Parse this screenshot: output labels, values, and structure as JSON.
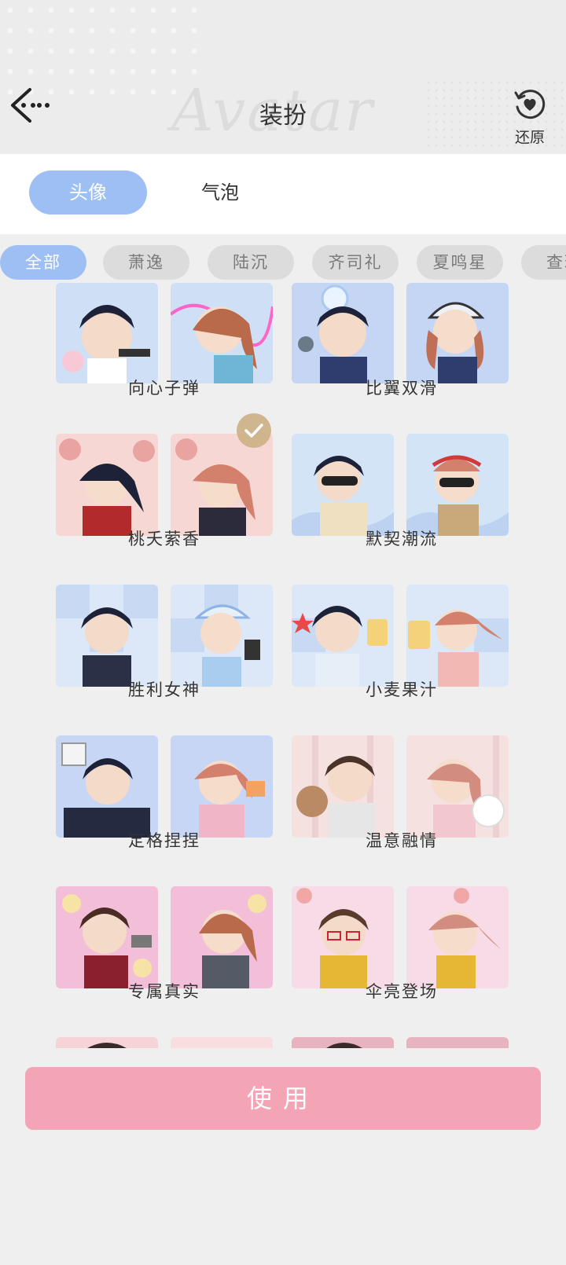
{
  "header": {
    "title": "装扮",
    "watermark": "Avatar",
    "restore_label": "还原",
    "icons": {
      "back": "back-arrow-icon",
      "restore": "heart-restore-icon"
    }
  },
  "tabs": [
    {
      "label": "头像",
      "active": true
    },
    {
      "label": "气泡",
      "active": false
    }
  ],
  "filters": [
    {
      "label": "全部",
      "active": true
    },
    {
      "label": "萧逸",
      "active": false
    },
    {
      "label": "陆沉",
      "active": false
    },
    {
      "label": "齐司礼",
      "active": false
    },
    {
      "label": "夏鸣星",
      "active": false
    },
    {
      "label": "查理",
      "active": false
    }
  ],
  "avatar_sets": [
    {
      "name": "向心子弹",
      "selected": false
    },
    {
      "name": "比翼双滑",
      "selected": false
    },
    {
      "name": "桃夭萦香",
      "selected": true
    },
    {
      "name": "默契潮流",
      "selected": false
    },
    {
      "name": "胜利女神",
      "selected": false
    },
    {
      "name": "小麦果汁",
      "selected": false
    },
    {
      "name": "定格捏捏",
      "selected": false
    },
    {
      "name": "温意融情",
      "selected": false
    },
    {
      "name": "专属真实",
      "selected": false
    },
    {
      "name": "伞亮登场",
      "selected": false
    }
  ],
  "colors": {
    "accent_blue": "#9dbff3",
    "use_button": "#f3a5b5",
    "selected_check": "#cdb287"
  },
  "use_button_label": "使用"
}
